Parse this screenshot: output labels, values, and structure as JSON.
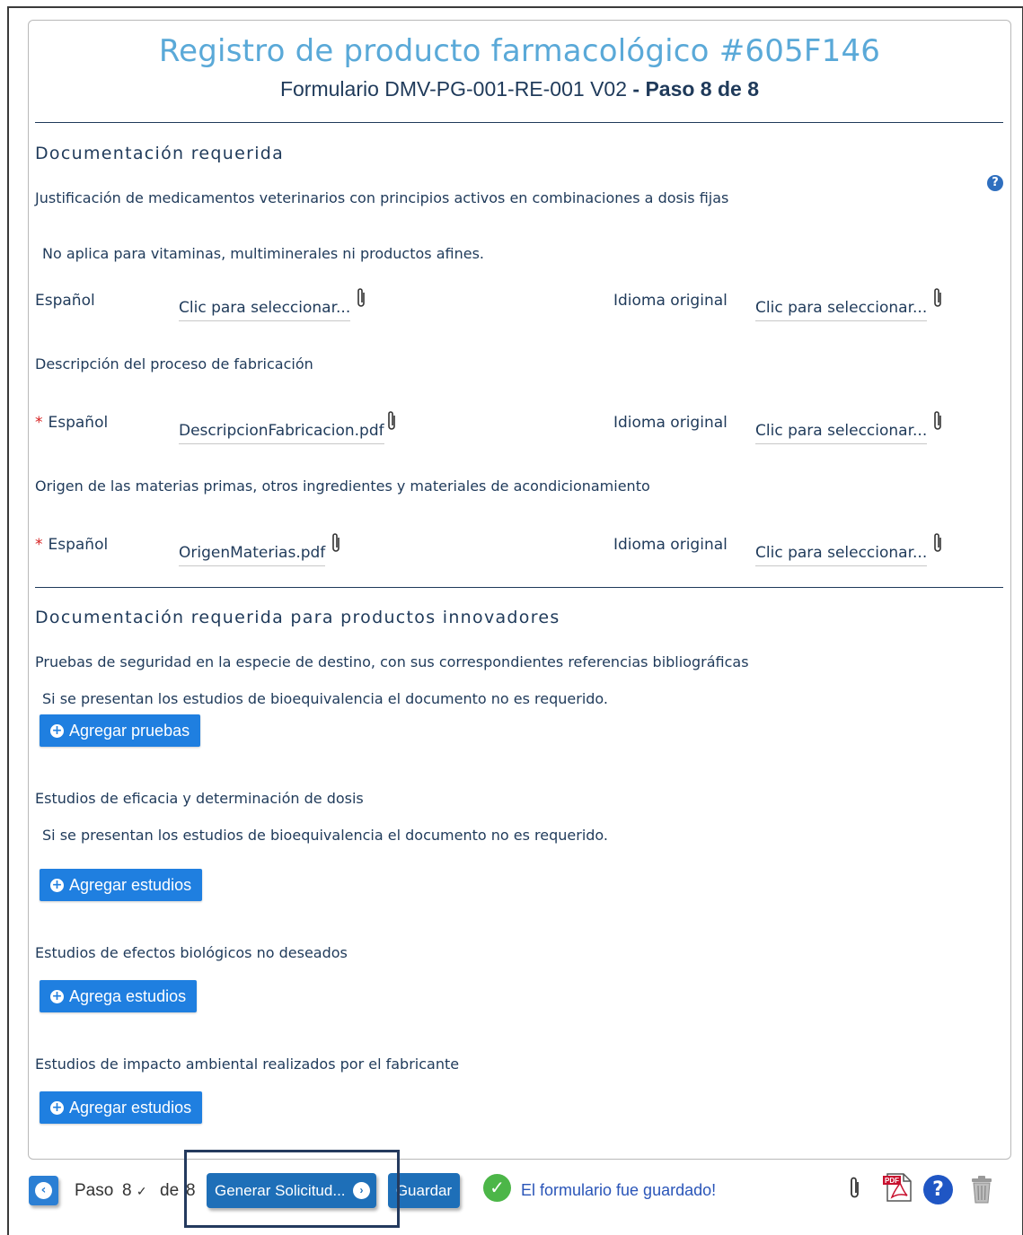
{
  "header": {
    "title": "Registro de producto farmacológico #605F146",
    "subtitle_main": "Formulario DMV-PG-001-RE-001 V02",
    "subtitle_step": " - Paso 8 de 8"
  },
  "section1": {
    "title": "Documentación requerida",
    "group1": {
      "heading": "Justificación de medicamentos veterinarios con principios activos en combinaciones a dosis fijas",
      "note": "No aplica para vitaminas, multiminerales ni productos afines.",
      "spanish_label": "Español",
      "spanish_value": "Clic para seleccionar...",
      "original_label": "Idioma original",
      "original_value": "Clic para seleccionar..."
    },
    "group2": {
      "heading": "Descripción del proceso de fabricación",
      "required_mark": "*",
      "spanish_label": "Español",
      "spanish_value": "DescripcionFabricacion.pdf",
      "original_label": "Idioma original",
      "original_value": "Clic para seleccionar..."
    },
    "group3": {
      "heading": "Origen de las materias primas, otros ingredientes y materiales de acondicionamiento",
      "required_mark": "*",
      "spanish_label": "Español",
      "spanish_value": "OrigenMaterias.pdf",
      "original_label": "Idioma original",
      "original_value": "Clic para seleccionar..."
    }
  },
  "section2": {
    "title": "Documentación requerida para productos innovadores",
    "group1": {
      "heading": "Pruebas de seguridad en la especie de destino, con sus correspondientes referencias bibliográficas",
      "note": "Si se presentan los estudios de bioequivalencia el documento no es requerido.",
      "button": "Agregar pruebas"
    },
    "group2": {
      "heading": "Estudios de eficacia y determinación de dosis",
      "note": "Si se presentan los estudios de bioequivalencia el documento no es requerido.",
      "button": "Agregar estudios"
    },
    "group3": {
      "heading": "Estudios de efectos biológicos no deseados",
      "button": "Agrega estudios"
    },
    "group4": {
      "heading": "Estudios de impacto ambiental realizados por el fabricante",
      "button": "Agregar estudios"
    }
  },
  "footer": {
    "paso_label": "Paso",
    "paso_value": "8",
    "de_label": "de",
    "total": "8",
    "generate_button": "Generar Solicitud...",
    "save_button": "Guardar",
    "saved_message": "El formulario fue guardado!",
    "pdf_badge": "PDF"
  },
  "icons": {
    "help": "question-circle-icon",
    "attach": "paperclip-icon",
    "pdf": "pdf-icon",
    "trash": "trash-icon",
    "check": "check-circle-icon"
  }
}
